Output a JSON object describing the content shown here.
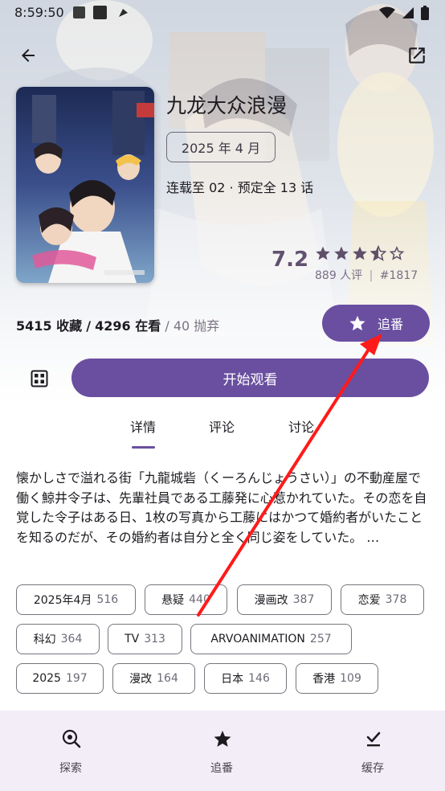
{
  "status_bar": {
    "time": "8:59:50"
  },
  "anime": {
    "title": "九龙大众浪漫",
    "air_date": "2025 年 4 月",
    "episodes": "连载至 02 · 预定全 13 话",
    "score": "7.2",
    "stars_filled": 3.5,
    "rating_count": "889 人评",
    "rank": "#1817"
  },
  "stats": {
    "favorites": "5415 收藏",
    "separator": "/",
    "watching": "4296 在看",
    "dropped": "/ 40 抛弃"
  },
  "actions": {
    "follow_label": "追番",
    "watch_label": "开始观看"
  },
  "tabs": [
    {
      "label": "详情"
    },
    {
      "label": "评论"
    },
    {
      "label": "讨论"
    }
  ],
  "description": "懐かしさで溢れる街「九龍城砦（くーろんじょうさい）」の不動産屋で働く鯨井令子は、先輩社員である工藤発に心惹かれていた。その恋を自覚した令子はある日、1枚の写真から工藤にはかつて婚約者がいたことを知るのだが、その婚約者は自分と全く同じ姿をしていた。 …",
  "tags": [
    {
      "name": "2025年4月",
      "count": "516"
    },
    {
      "name": "悬疑",
      "count": "440"
    },
    {
      "name": "漫画改",
      "count": "387"
    },
    {
      "name": "恋爱",
      "count": "378"
    },
    {
      "name": "科幻",
      "count": "364"
    },
    {
      "name": "TV",
      "count": "313"
    },
    {
      "name": "ARVOANIMATION",
      "count": "257"
    },
    {
      "name": "2025",
      "count": "197"
    },
    {
      "name": "漫改",
      "count": "164"
    },
    {
      "name": "日本",
      "count": "146"
    },
    {
      "name": "香港",
      "count": "109"
    }
  ],
  "bottom_nav": [
    {
      "label": "探索",
      "icon": "explore-icon"
    },
    {
      "label": "追番",
      "icon": "star-icon"
    },
    {
      "label": "缓存",
      "icon": "download-done-icon"
    }
  ],
  "colors": {
    "accent": "#6a4fa0",
    "score": "#625170",
    "nav_background": "#f3edf7",
    "annotation_arrow": "#ff1a1a"
  }
}
